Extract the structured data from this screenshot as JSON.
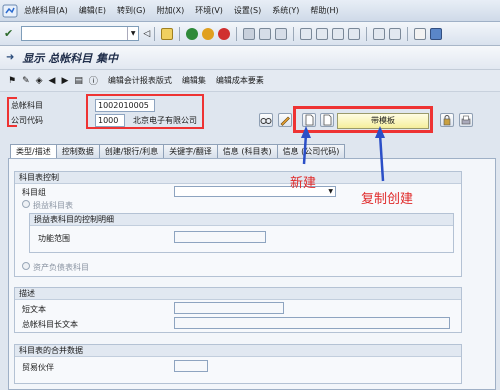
{
  "menu": [
    "总帐科目(A)",
    "编辑(E)",
    "转到(G)",
    "附加(X)",
    "环境(V)",
    "设置(S)",
    "系统(Y)",
    "帮助(H)"
  ],
  "title": "显示 总帐科目 集中",
  "app_toolbar": [
    "编辑会计报表版式",
    "编辑集",
    "编辑成本要素"
  ],
  "fields": {
    "gl_label": "总帐科目",
    "gl_value": "1002010005",
    "company_label": "公司代码",
    "company_value": "1000",
    "company_name": "北京电子有限公司"
  },
  "template_button": "带模板",
  "tabs": [
    "类型/描述",
    "控制数据",
    "创建/银行/利息",
    "关键字/翻译",
    "信息 (科目表)",
    "信息 (公司代码)"
  ],
  "active_tab": 0,
  "section_control": {
    "title": "科目表控制",
    "account_group_label": "科目组",
    "pl_radio_label": "损益科目表",
    "pl_group_title": "损益表科目的控制明细",
    "func_area_label": "功能范围",
    "bs_radio_label": "资产负债表科目"
  },
  "section_desc": {
    "title": "描述",
    "short_label": "短文本",
    "long_label": "总帐科目长文本"
  },
  "section_consol": {
    "title": "科目表的合并数据",
    "partner_label": "贸易伙伴"
  },
  "annotations": {
    "new": "新建",
    "copy": "复制创建"
  },
  "colors": {
    "annotation_red": "#e33333",
    "arrow_blue": "#2b4fc7"
  }
}
